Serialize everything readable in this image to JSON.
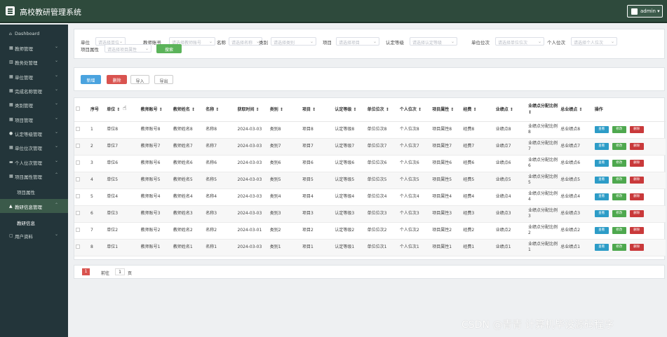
{
  "app": {
    "title": "高校教研管理系统",
    "user": "admin ▾"
  },
  "sidebar": {
    "items": [
      {
        "icon": "⌂",
        "label": "Dashboard",
        "chevron": ""
      },
      {
        "icon": "▦",
        "label": "教师管理",
        "chevron": "⌄"
      },
      {
        "icon": "▥",
        "label": "教务处管理",
        "chevron": "⌄"
      },
      {
        "icon": "▦",
        "label": "单位管理",
        "chevron": "⌄"
      },
      {
        "icon": "▦",
        "label": "完成名称管理",
        "chevron": "⌄"
      },
      {
        "icon": "▦",
        "label": "类别管理",
        "chevron": "⌄"
      },
      {
        "icon": "▦",
        "label": "项目管理",
        "chevron": "⌄"
      },
      {
        "icon": "●",
        "label": "认定等级管理",
        "chevron": "⌄"
      },
      {
        "icon": "▦",
        "label": "单位位次管理",
        "chevron": "⌄"
      },
      {
        "icon": "▬",
        "label": "个人位次管理",
        "chevron": "⌄"
      },
      {
        "icon": "▦",
        "label": "项目属性管理",
        "chevron": "⌃"
      }
    ],
    "sub_item": "项目属性",
    "active_item": {
      "icon": "▲",
      "label": "教研信息管理",
      "chevron": "⌃"
    },
    "active_sub": "教研信息",
    "last_item": {
      "icon": "▢",
      "label": "用户资料",
      "chevron": "⌄"
    }
  },
  "search": {
    "fields": [
      {
        "label": "单位",
        "placeholder": "请选择单位"
      },
      {
        "label": "教师账号",
        "placeholder": "请选择教师账号"
      },
      {
        "label": "名称",
        "placeholder": "请选择名称"
      },
      {
        "label": "类别",
        "placeholder": "请选择类别"
      },
      {
        "label": "项目",
        "placeholder": "请选择项目"
      },
      {
        "label": "认定等级",
        "placeholder": "请选择认定等级"
      },
      {
        "label": "单位位次",
        "placeholder": "请选择单位位次"
      },
      {
        "label": "个人位次",
        "placeholder": "请选择个人位次"
      },
      {
        "label": "项目属性",
        "placeholder": "请选择项目属性"
      }
    ],
    "button": "搜索"
  },
  "actions": {
    "add": "新增",
    "delete": "删除",
    "import": "导入",
    "export": "导出"
  },
  "table": {
    "headers": [
      "序号",
      "单位 ↕",
      "教师账号 ↕",
      "教师姓名 ↕",
      "名称 ↕",
      "获取时间 ↕",
      "类别 ↕",
      "项目 ↕",
      "认定等级 ↕",
      "单位位次 ↕",
      "个人位次 ↕",
      "项目属性 ↕",
      "经费 ↕",
      "业绩点 ↕",
      "业绩点分配比例 ↕",
      "总业绩点 ↕",
      "操作"
    ],
    "rows": [
      [
        "1",
        "单位8",
        "教师账号8",
        "教师姓名8",
        "名称8",
        "2024-03-03",
        "类别8",
        "项目8",
        "认定等级8",
        "单位位次8",
        "个人位次8",
        "项目属性8",
        "经费8",
        "业绩点8",
        "业绩点分配比例8",
        "总业绩点8"
      ],
      [
        "2",
        "单位7",
        "教师账号7",
        "教师姓名7",
        "名称7",
        "2024-03-03",
        "类别7",
        "项目7",
        "认定等级7",
        "单位位次7",
        "个人位次7",
        "项目属性7",
        "经费7",
        "业绩点7",
        "业绩点分配比例7",
        "总业绩点7"
      ],
      [
        "3",
        "单位6",
        "教师账号6",
        "教师姓名6",
        "名称6",
        "2024-03-03",
        "类别6",
        "项目6",
        "认定等级6",
        "单位位次6",
        "个人位次6",
        "项目属性6",
        "经费6",
        "业绩点6",
        "业绩点分配比例6",
        "总业绩点6"
      ],
      [
        "4",
        "单位5",
        "教师账号5",
        "教师姓名5",
        "名称5",
        "2024-03-03",
        "类别5",
        "项目5",
        "认定等级5",
        "单位位次5",
        "个人位次5",
        "项目属性5",
        "经费5",
        "业绩点5",
        "业绩点分配比例5",
        "总业绩点5"
      ],
      [
        "5",
        "单位4",
        "教师账号4",
        "教师姓名4",
        "名称4",
        "2024-03-03",
        "类别4",
        "项目4",
        "认定等级4",
        "单位位次4",
        "个人位次4",
        "项目属性4",
        "经费4",
        "业绩点4",
        "业绩点分配比例4",
        "总业绩点4"
      ],
      [
        "6",
        "单位3",
        "教师账号3",
        "教师姓名3",
        "名称3",
        "2024-03-03",
        "类别3",
        "项目3",
        "认定等级3",
        "单位位次3",
        "个人位次3",
        "项目属性3",
        "经费3",
        "业绩点3",
        "业绩点分配比例3",
        "总业绩点3"
      ],
      [
        "7",
        "单位2",
        "教师账号2",
        "教师姓名2",
        "名称2",
        "2024-03-01",
        "类别2",
        "项目2",
        "认定等级2",
        "单位位次2",
        "个人位次2",
        "项目属性2",
        "经费2",
        "业绩点2",
        "业绩点分配比例2",
        "总业绩点2"
      ],
      [
        "8",
        "单位1",
        "教师账号1",
        "教师姓名1",
        "名称1",
        "2024-03-03",
        "类别1",
        "项目1",
        "认定等级1",
        "单位位次1",
        "个人位次1",
        "项目属性1",
        "经费1",
        "业绩点1",
        "业绩点分配比例1",
        "总业绩点1"
      ]
    ],
    "row_actions": {
      "view": "查看",
      "edit": "修改",
      "delete": "删除"
    }
  },
  "pager": {
    "current": "1",
    "goto": "前往",
    "page_input": "1",
    "page_suffix": "页"
  },
  "watermark": "CSDN @青青 计算机毕设源码程序"
}
